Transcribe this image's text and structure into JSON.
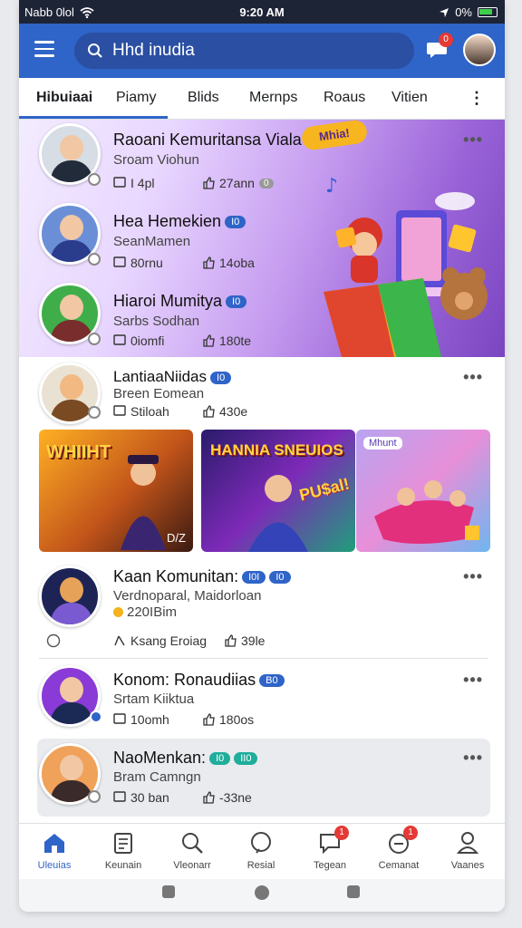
{
  "status_bar": {
    "carrier": "Nabb 0lol",
    "time": "9:20 AM",
    "signal_percent": "0%"
  },
  "header": {
    "search_placeholder": "Hhd inudia",
    "chat_badge": "0"
  },
  "tabs": [
    {
      "label": "Hibuiaai",
      "active": true
    },
    {
      "label": "Piamy",
      "active": false
    },
    {
      "label": "Blids",
      "active": false
    },
    {
      "label": "Mernps",
      "active": false
    },
    {
      "label": "Roaus",
      "active": false
    },
    {
      "label": "Vitien",
      "active": false
    }
  ],
  "banner": {
    "tag": "Mhia!"
  },
  "featured": [
    {
      "title": "Raoani Kemuritansa Viala",
      "sub": "Sroam Viohun",
      "stat1": "I 4pl",
      "stat2": "27ann",
      "stat2_badge": "0"
    },
    {
      "title": "Hea Hemekien",
      "pill": "I0",
      "sub": "SeanMamen",
      "stat1": "80rnu",
      "stat2": "14oba"
    },
    {
      "title": "Hiaroi Mumitya",
      "pill": "I0",
      "sub": "Sarbs Sodhan",
      "stat1": "0iomfi",
      "stat2": "180te"
    }
  ],
  "posts": [
    {
      "title": "LantiaaNiidas",
      "pill": "I0",
      "sub": "Breen Eomean",
      "stat1": "Stiloah",
      "stat2": "430e"
    },
    {
      "title": "Kaan Komunitan:",
      "pill": "I0I",
      "pill2": "I0",
      "sub": "Verdnoparal, Maidorloan",
      "sub2": "220IBim",
      "stat1": "Ksang Eroiag",
      "stat2": "39le"
    },
    {
      "title": "Konom: Ronaudiias",
      "pill": "B0",
      "sub": "Srtam Kiiktua",
      "stat1": "10omh",
      "stat2": "180os"
    },
    {
      "title": "NaoMenkan:",
      "pill": "I0",
      "pill2": "II0",
      "sub": "Bram Camngn",
      "stat1": "30 ban",
      "stat2": "-33ne"
    }
  ],
  "thumbnails": [
    {
      "label": "WHIIHT"
    },
    {
      "label": "HANNIA SNEUIOS"
    },
    {
      "label": "Mhunt"
    }
  ],
  "thumb_sub_label": "PU$al!",
  "thumb_corner_label": "D/Z",
  "bottom_nav": [
    {
      "label": "Uleuias",
      "icon": "home-icon",
      "active": true
    },
    {
      "label": "Keunain",
      "icon": "clipboard-icon",
      "active": false
    },
    {
      "label": "Vleonarr",
      "icon": "search-icon",
      "active": false
    },
    {
      "label": "Resial",
      "icon": "chat-bubble-icon",
      "active": false
    },
    {
      "label": "Tegean",
      "icon": "message-icon",
      "active": false,
      "badge": "1"
    },
    {
      "label": "Cemanat",
      "icon": "timer-icon",
      "active": false,
      "badge": "1"
    },
    {
      "label": "Vaanes",
      "icon": "person-icon",
      "active": false
    }
  ],
  "colors": {
    "primary": "#2f64c8",
    "status_bg": "#1d2436",
    "badge": "#e53935"
  }
}
